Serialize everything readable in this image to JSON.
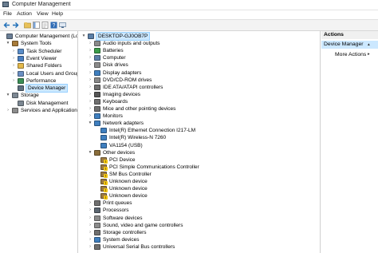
{
  "window": {
    "title": "Computer Management"
  },
  "menu": [
    "File",
    "Action",
    "View",
    "Help"
  ],
  "left_tree": [
    {
      "label": "Computer Management (Local",
      "level": 0,
      "arrow": "",
      "icon": "computer-management-icon",
      "color": "#6b7f96",
      "selected": false
    },
    {
      "label": "System Tools",
      "level": 1,
      "arrow": "▾",
      "icon": "system-tools-icon",
      "color": "#a77b3a",
      "selected": false
    },
    {
      "label": "Task Scheduler",
      "level": 2,
      "arrow": "›",
      "icon": "task-scheduler-icon",
      "color": "#5a8dc8",
      "selected": false
    },
    {
      "label": "Event Viewer",
      "level": 2,
      "arrow": "›",
      "icon": "event-viewer-icon",
      "color": "#4a7fc0",
      "selected": false
    },
    {
      "label": "Shared Folders",
      "level": 2,
      "arrow": "›",
      "icon": "shared-folder-icon",
      "color": "#e3b94c",
      "selected": false
    },
    {
      "label": "Local Users and Groups",
      "level": 2,
      "arrow": "›",
      "icon": "users-icon",
      "color": "#6a8fc2",
      "selected": false
    },
    {
      "label": "Performance",
      "level": 2,
      "arrow": "›",
      "icon": "performance-icon",
      "color": "#3b8f56",
      "selected": false
    },
    {
      "label": "Device Manager",
      "level": 2,
      "arrow": "",
      "icon": "device-manager-icon",
      "color": "#5e6f80",
      "selected": true
    },
    {
      "label": "Storage",
      "level": 1,
      "arrow": "▾",
      "icon": "storage-icon",
      "color": "#7c8792",
      "selected": false
    },
    {
      "label": "Disk Management",
      "level": 2,
      "arrow": "",
      "icon": "disk-management-icon",
      "color": "#7c8792",
      "selected": false
    },
    {
      "label": "Services and Applications",
      "level": 1,
      "arrow": "›",
      "icon": "services-icon",
      "color": "#8c8c8c",
      "selected": false
    }
  ],
  "device_tree": [
    {
      "label": "DESKTOP-GJ0OB7P",
      "level": 0,
      "arrow": "▾",
      "icon": "computer-icon",
      "color": "#5b7fa7",
      "selected": true
    },
    {
      "label": "Audio inputs and outputs",
      "level": 1,
      "arrow": "›",
      "icon": "audio-icon",
      "color": "#8a8a8a"
    },
    {
      "label": "Batteries",
      "level": 1,
      "arrow": "›",
      "icon": "battery-icon",
      "color": "#3b9d4a"
    },
    {
      "label": "Computer",
      "level": 1,
      "arrow": "›",
      "icon": "computer-icon",
      "color": "#5b7fa7"
    },
    {
      "label": "Disk drives",
      "level": 1,
      "arrow": "›",
      "icon": "disk-drive-icon",
      "color": "#8a8a8a"
    },
    {
      "label": "Display adapters",
      "level": 1,
      "arrow": "›",
      "icon": "display-adapter-icon",
      "color": "#3f7fbf"
    },
    {
      "label": "DVD/CD-ROM drives",
      "level": 1,
      "arrow": "›",
      "icon": "dvd-drive-icon",
      "color": "#8a8a8a"
    },
    {
      "label": "IDE ATA/ATAPI controllers",
      "level": 1,
      "arrow": "›",
      "icon": "ide-controller-icon",
      "color": "#6f6f6f"
    },
    {
      "label": "Imaging devices",
      "level": 1,
      "arrow": "›",
      "icon": "camera-icon",
      "color": "#555555"
    },
    {
      "label": "Keyboards",
      "level": 1,
      "arrow": "›",
      "icon": "keyboard-icon",
      "color": "#6f6f6f"
    },
    {
      "label": "Mice and other pointing devices",
      "level": 1,
      "arrow": "›",
      "icon": "mouse-icon",
      "color": "#6f6f6f"
    },
    {
      "label": "Monitors",
      "level": 1,
      "arrow": "›",
      "icon": "monitor-icon",
      "color": "#3f7fbf"
    },
    {
      "label": "Network adapters",
      "level": 1,
      "arrow": "▾",
      "icon": "network-adapter-icon",
      "color": "#3f7fbf"
    },
    {
      "label": "Intel(R) Ethernet Connection I217-LM",
      "level": 2,
      "arrow": "",
      "icon": "network-adapter-icon",
      "color": "#3f7fbf"
    },
    {
      "label": "Intel(R) Wireless-N 7260",
      "level": 2,
      "arrow": "",
      "icon": "network-adapter-icon",
      "color": "#3f7fbf"
    },
    {
      "label": "VA1154 (USB)",
      "level": 2,
      "arrow": "",
      "icon": "network-adapter-icon",
      "color": "#3f7fbf"
    },
    {
      "label": "Other devices",
      "level": 1,
      "arrow": "▾",
      "icon": "unknown-device-icon",
      "color": "#8a6d3b"
    },
    {
      "label": "PCI Device",
      "level": 2,
      "arrow": "",
      "icon": "warning-device-icon",
      "color": "#8a6d3b"
    },
    {
      "label": "PCI Simple Communications Controller",
      "level": 2,
      "arrow": "",
      "icon": "warning-device-icon",
      "color": "#8a6d3b"
    },
    {
      "label": "SM Bus Controller",
      "level": 2,
      "arrow": "",
      "icon": "warning-device-icon",
      "color": "#8a6d3b"
    },
    {
      "label": "Unknown device",
      "level": 2,
      "arrow": "",
      "icon": "warning-device-icon",
      "color": "#8a6d3b"
    },
    {
      "label": "Unknown device",
      "level": 2,
      "arrow": "",
      "icon": "warning-device-icon",
      "color": "#8a6d3b"
    },
    {
      "label": "Unknown device",
      "level": 2,
      "arrow": "",
      "icon": "warning-device-icon",
      "color": "#8a6d3b"
    },
    {
      "label": "Print queues",
      "level": 1,
      "arrow": "›",
      "icon": "printer-icon",
      "color": "#6f6f6f"
    },
    {
      "label": "Processors",
      "level": 1,
      "arrow": "›",
      "icon": "processor-icon",
      "color": "#5c6670"
    },
    {
      "label": "Software devices",
      "level": 1,
      "arrow": "›",
      "icon": "software-device-icon",
      "color": "#8a8a8a"
    },
    {
      "label": "Sound, video and game controllers",
      "level": 1,
      "arrow": "›",
      "icon": "sound-icon",
      "color": "#8a8a8a"
    },
    {
      "label": "Storage controllers",
      "level": 1,
      "arrow": "›",
      "icon": "storage-controller-icon",
      "color": "#6f6f6f"
    },
    {
      "label": "System devices",
      "level": 1,
      "arrow": "›",
      "icon": "system-device-icon",
      "color": "#3f7fbf"
    },
    {
      "label": "Universal Serial Bus controllers",
      "level": 1,
      "arrow": "›",
      "icon": "usb-icon",
      "color": "#6f6f6f"
    }
  ],
  "actions": {
    "header": "Actions",
    "section": "Device Manager",
    "more": "More Actions"
  },
  "colors": {
    "selection": "#cce8ff",
    "actions_header": "#f0f0f0"
  }
}
